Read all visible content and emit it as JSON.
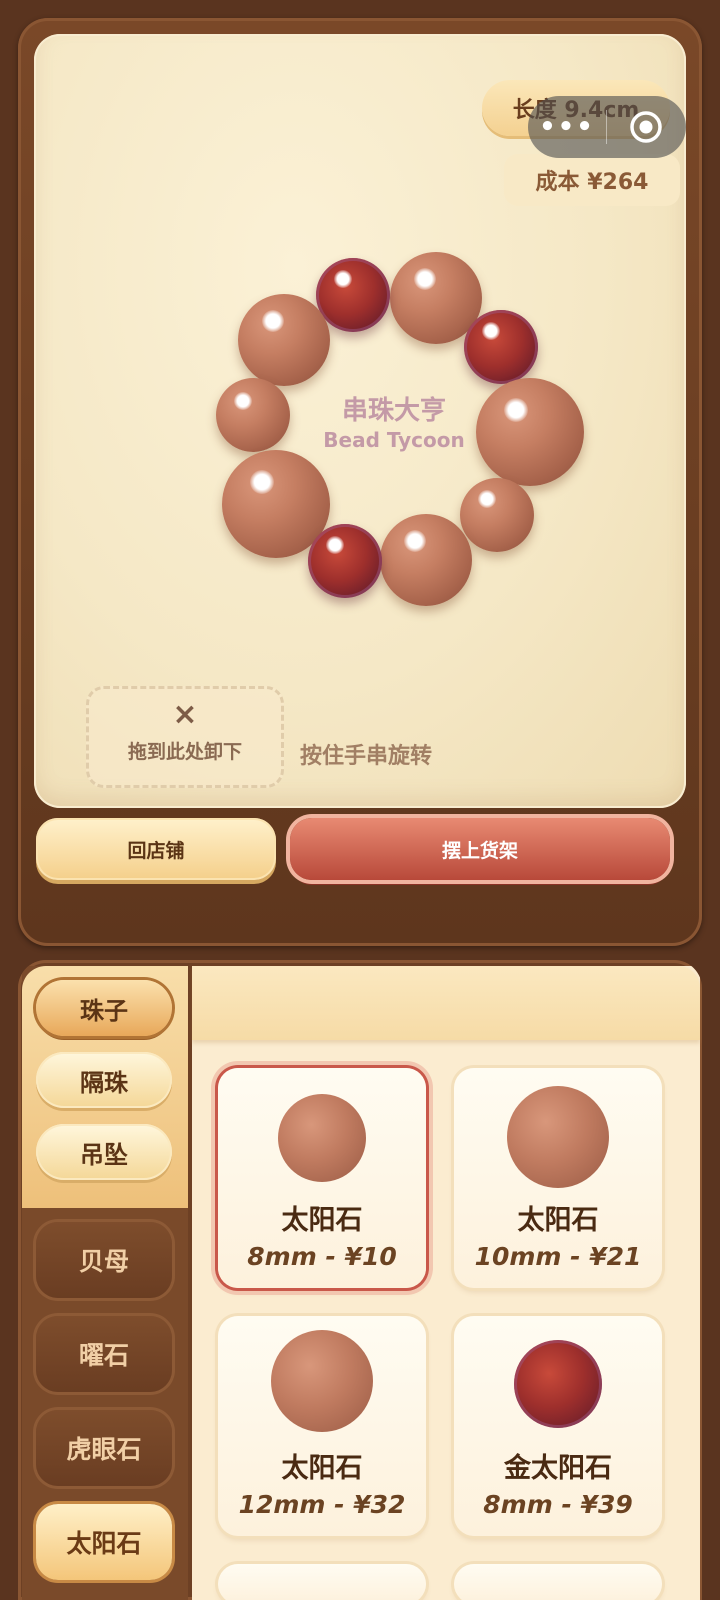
{
  "header": {
    "length_label": "长度 9.4cm",
    "cost_label": "成本 ¥264"
  },
  "mini_program_capsule": {
    "more_icon": "more-dots-icon",
    "close_icon": "target-circle-icon"
  },
  "bracelet": {
    "brand_cn": "串珠大亨",
    "brand_en": "Bead Tycoon",
    "beads": [
      "太阳石",
      "金太阳石",
      "太阳石",
      "金太阳石",
      "太阳石",
      "太阳石",
      "太阳石",
      "金太阳石",
      "太阳石",
      "太阳石"
    ]
  },
  "workspace": {
    "drop_zone_icon": "×",
    "drop_zone_label": "拖到此处卸下",
    "hint": "按住手串旋转"
  },
  "actions": {
    "back_label": "回店铺",
    "shelf_label": "摆上货架"
  },
  "sidebar": {
    "categories": [
      {
        "label": "珠子",
        "active": true
      },
      {
        "label": "隔珠",
        "active": false
      },
      {
        "label": "吊坠",
        "active": false
      }
    ],
    "materials": [
      {
        "label": "贝母",
        "active": false
      },
      {
        "label": "曜石",
        "active": false
      },
      {
        "label": "虎眼石",
        "active": false
      },
      {
        "label": "太阳石",
        "active": true
      }
    ]
  },
  "products": [
    {
      "name": "太阳石",
      "price": "8mm - ¥10",
      "selected": true
    },
    {
      "name": "太阳石",
      "price": "10mm - ¥21",
      "selected": false
    },
    {
      "name": "太阳石",
      "price": "12mm - ¥32",
      "selected": false
    },
    {
      "name": "金太阳石",
      "price": "8mm - ¥39",
      "selected": false
    }
  ],
  "colors": {
    "panel_brown": "#5a341f",
    "accent_red": "#c9584a",
    "gold": "#f4d191"
  }
}
